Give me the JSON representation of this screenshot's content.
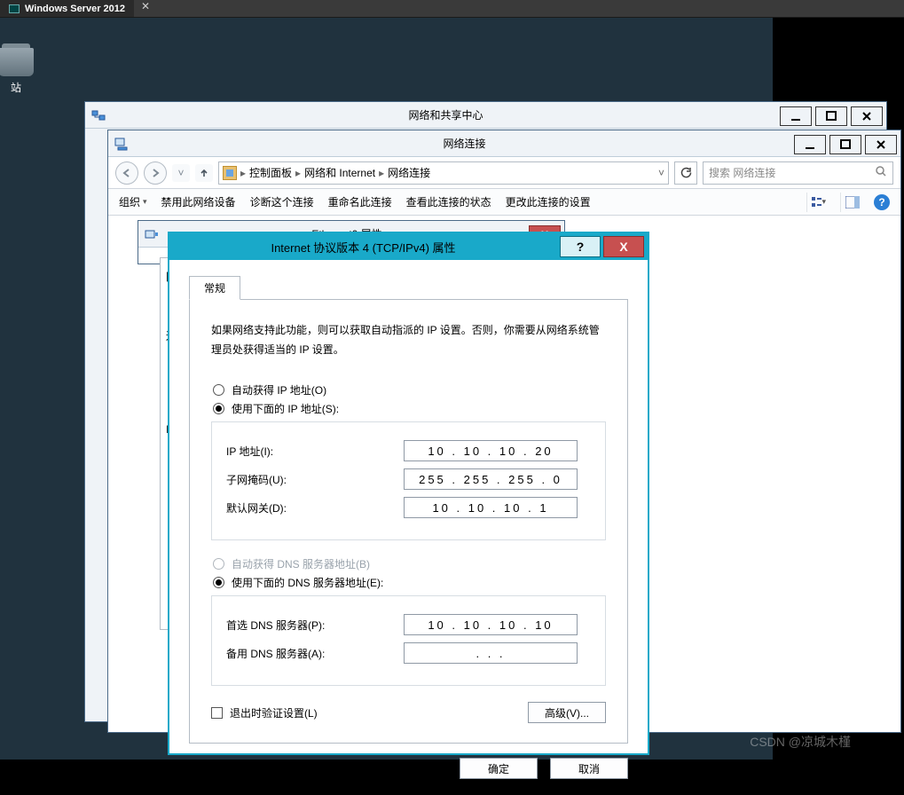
{
  "vm": {
    "tab_label": "Windows Server 2012",
    "close_glyph": "✕"
  },
  "desktop": {
    "recycle_bin_label": "站"
  },
  "win1": {
    "title": "网络和共享中心"
  },
  "win2": {
    "title": "网络连接",
    "breadcrumb": {
      "seg1": "控制面板",
      "seg2": "网络和 Internet",
      "seg3": "网络连接",
      "sep": "▸",
      "drop": "˅"
    },
    "search_placeholder": "搜索 网络连接",
    "toolbar": {
      "organize": "组织",
      "drop_glyph": "▾",
      "disable": "禁用此网络设备",
      "diagnose": "诊断这个连接",
      "rename": "重命名此连接",
      "status": "查看此连接的状态",
      "change": "更改此连接的设置",
      "help_glyph": "?"
    }
  },
  "eth": {
    "title": "Ethernet0 属性",
    "close": "X"
  },
  "overlap": {
    "line1": "网",
    "line2": "辽",
    "line3": "I"
  },
  "ipv4": {
    "title": "Internet 协议版本 4 (TCP/IPv4) 属性",
    "help": "?",
    "close": "X",
    "tab_general": "常规",
    "explain": "如果网络支持此功能，则可以获取自动指派的 IP 设置。否则，你需要从网络系统管理员处获得适当的 IP 设置。",
    "r_auto_ip": "自动获得 IP 地址(O)",
    "r_manual_ip": "使用下面的 IP 地址(S):",
    "lbl_ip": "IP 地址(I):",
    "val_ip": "10  .  10  .  10  .  20",
    "lbl_mask": "子网掩码(U):",
    "val_mask": "255 . 255 . 255 .   0",
    "lbl_gw": "默认网关(D):",
    "val_gw": "10  .  10  .  10  .   1",
    "r_auto_dns": "自动获得 DNS 服务器地址(B)",
    "r_manual_dns": "使用下面的 DNS 服务器地址(E):",
    "lbl_dns1": "首选 DNS 服务器(P):",
    "val_dns1": "10  .  10  .  10  . 10",
    "lbl_dns2": "备用 DNS 服务器(A):",
    "val_dns2": " .       .       . ",
    "chk_validate": "退出时验证设置(L)",
    "btn_adv": "高级(V)...",
    "btn_ok": "确定",
    "btn_cancel": "取消"
  },
  "watermark": "CSDN @凉城木槿"
}
